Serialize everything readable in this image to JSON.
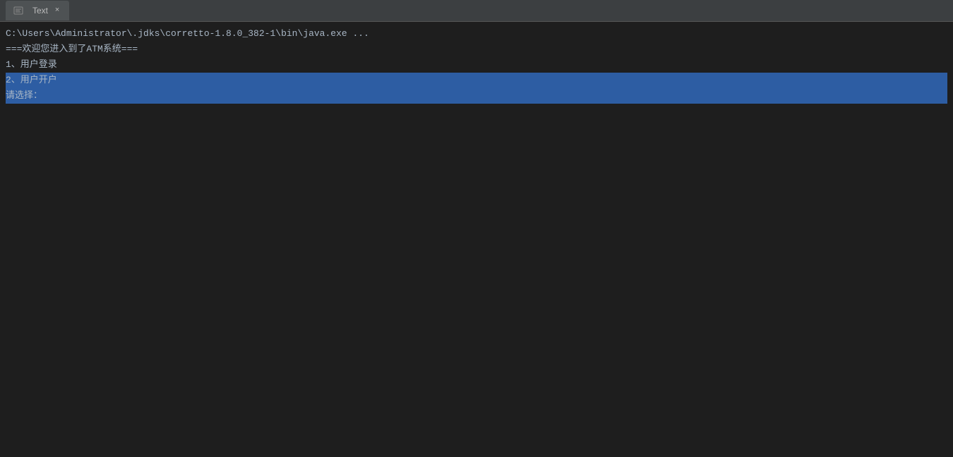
{
  "titleBar": {
    "tabLabel": "Text",
    "closeSymbol": "×"
  },
  "console": {
    "lines": [
      {
        "id": "command",
        "text": "C:\\Users\\Administrator\\.jdks\\corretto-1.8.0_382-1\\bin\\java.exe ...",
        "type": "command"
      },
      {
        "id": "welcome",
        "text": "===欢迎您进入到了ATM系统===",
        "type": "welcome"
      },
      {
        "id": "menu1",
        "text": "1、用户登录",
        "type": "menu-item"
      },
      {
        "id": "menu2",
        "text": "2、用户开户",
        "type": "highlighted"
      },
      {
        "id": "prompt",
        "text": "请选择：",
        "type": "prompt"
      }
    ]
  }
}
